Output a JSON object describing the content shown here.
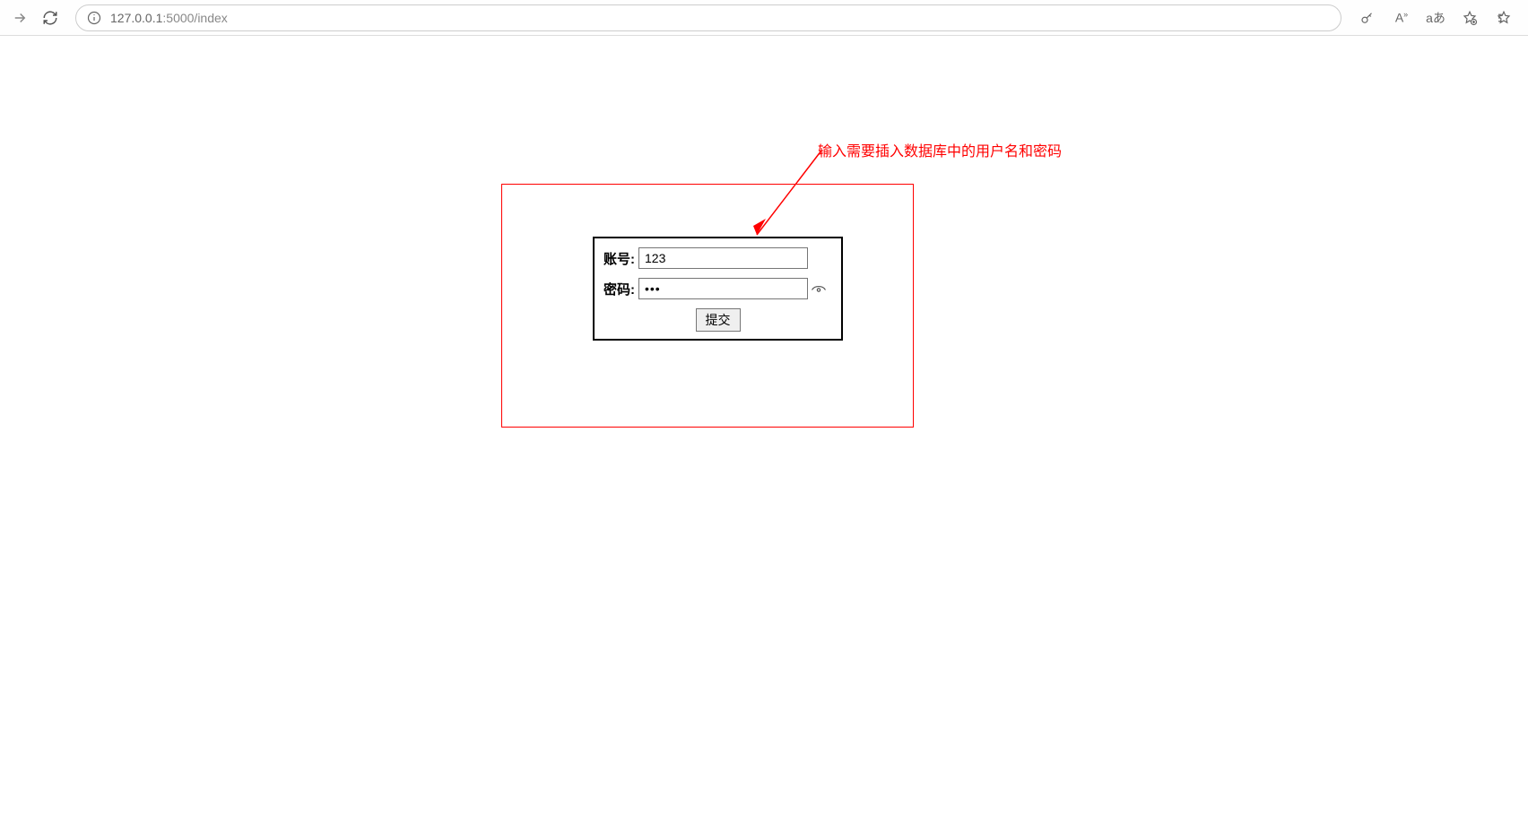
{
  "browser": {
    "url_host": "127.0.0.1",
    "url_port_path": ":5000/index"
  },
  "annotation": {
    "text": "输入需要插入数据库中的用户名和密码"
  },
  "form": {
    "account_label": "账号:",
    "account_value": "123",
    "password_label": "密码:",
    "password_value": "•••",
    "submit_label": "提交"
  }
}
